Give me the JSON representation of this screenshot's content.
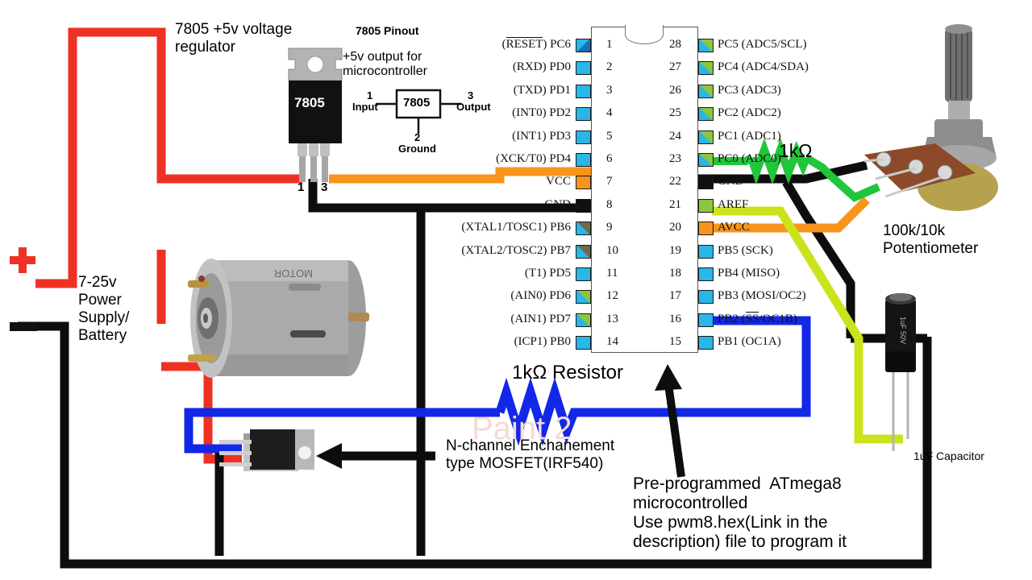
{
  "diagram": {
    "title_texts": {
      "regulator_note": "7805 +5v voltage\nregulator",
      "pinout_title": "7805 Pinout",
      "reg_output_note": "+5v output for\nmicrocontroller",
      "power_note": "7-25v\nPower\nSupply/\nBattery",
      "pot_note": "100k/10k\nPotentiometer",
      "pot_resistor": "1kΩ",
      "cap_note": "1uF Capacitor",
      "resistor_note": "1kΩ Resistor",
      "mosfet_note": "N-channel Enchanement\ntype MOSFET(IRF540)",
      "mcu_note": "Pre-programmed  ATmega8\nmicrocontrolled\nUse pwm8.hex(Link in the\ndescription) file to program it",
      "watermark": "Paint 2"
    },
    "regulator": {
      "body_label": "7805",
      "pin_left": "1",
      "pin_right": "3",
      "block_label": "7805",
      "block_in_num": "1",
      "block_in_text": "Input",
      "block_out_num": "3",
      "block_out_text": "Output",
      "block_gnd_num": "2",
      "block_gnd_text": "Ground"
    },
    "chip": {
      "left_pins": [
        {
          "num": "1",
          "label": "(RESET) PC6",
          "overline": "RESET",
          "pad": "navy-blue"
        },
        {
          "num": "2",
          "label": "(RXD) PD0",
          "pad": "cyan"
        },
        {
          "num": "3",
          "label": "(TXD) PD1",
          "pad": "cyan"
        },
        {
          "num": "4",
          "label": "(INT0) PD2",
          "pad": "cyan"
        },
        {
          "num": "5",
          "label": "(INT1) PD3",
          "pad": "cyan"
        },
        {
          "num": "6",
          "label": "(XCK/T0) PD4",
          "pad": "cyan"
        },
        {
          "num": "7",
          "label": "VCC",
          "pad": "orange"
        },
        {
          "num": "8",
          "label": "GND",
          "pad": "black"
        },
        {
          "num": "9",
          "label": "(XTAL1/TOSC1) PB6",
          "pad": "cyan-gray"
        },
        {
          "num": "10",
          "label": "(XTAL2/TOSC2) PB7",
          "pad": "cyan-gray"
        },
        {
          "num": "11",
          "label": "(T1) PD5",
          "pad": "cyan"
        },
        {
          "num": "12",
          "label": "(AIN0) PD6",
          "pad": "cyan-green"
        },
        {
          "num": "13",
          "label": "(AIN1) PD7",
          "pad": "cyan-green"
        },
        {
          "num": "14",
          "label": "(ICP1) PB0",
          "pad": "cyan"
        }
      ],
      "right_pins": [
        {
          "num": "28",
          "label": "PC5 (ADC5/SCL)",
          "pad": "cyan-green"
        },
        {
          "num": "27",
          "label": "PC4 (ADC4/SDA)",
          "pad": "cyan-green"
        },
        {
          "num": "26",
          "label": "PC3 (ADC3)",
          "pad": "cyan-green"
        },
        {
          "num": "25",
          "label": "PC2 (ADC2)",
          "pad": "cyan-green"
        },
        {
          "num": "24",
          "label": "PC1 (ADC1)",
          "pad": "cyan-green"
        },
        {
          "num": "23",
          "label": "PC0 (ADC0)",
          "pad": "cyan-green"
        },
        {
          "num": "22",
          "label": "GND",
          "pad": "black"
        },
        {
          "num": "21",
          "label": "AREF",
          "pad": "green"
        },
        {
          "num": "20",
          "label": "AVCC",
          "pad": "orange"
        },
        {
          "num": "19",
          "label": "PB5 (SCK)",
          "pad": "cyan"
        },
        {
          "num": "18",
          "label": "PB4 (MISO)",
          "pad": "cyan"
        },
        {
          "num": "17",
          "label": "PB3 (MOSI/OC2)",
          "pad": "cyan"
        },
        {
          "num": "16",
          "label": "PB2 (SS/OC1B)",
          "overline": "SS",
          "pad": "cyan"
        },
        {
          "num": "15",
          "label": "PB1 (OC1A)",
          "pad": "cyan"
        }
      ]
    },
    "colors": {
      "wire_red": "#ef3124",
      "wire_black": "#0d0d0d",
      "wire_orange": "#f7941e",
      "wire_blue": "#1327e8",
      "wire_green": "#22c63a",
      "wire_yellowgreen": "#cbe31c",
      "pad_cyan": "#29b6e8",
      "pad_green": "#8cc63f",
      "pad_navy": "#1172b5",
      "chip_outline": "#555555"
    }
  }
}
